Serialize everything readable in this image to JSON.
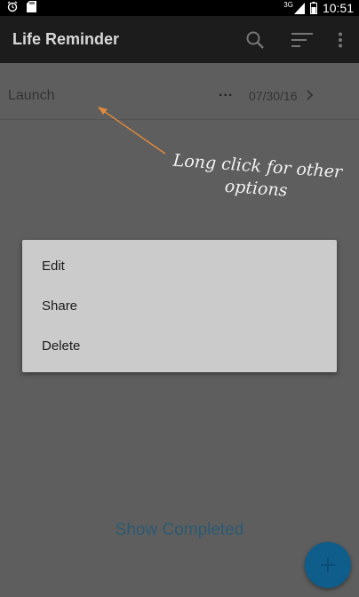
{
  "status_bar": {
    "time": "10:51",
    "network": "3G",
    "icons": [
      "alarm-icon",
      "sd-card-icon",
      "signal-icon",
      "battery-icon"
    ]
  },
  "app_bar": {
    "title": "Life Reminder",
    "actions": [
      "search-icon",
      "sort-icon",
      "overflow-menu-icon"
    ]
  },
  "list": {
    "items": [
      {
        "title": "Launch",
        "more": "...",
        "date": "07/30/16"
      }
    ]
  },
  "hint": {
    "text": "Long click for other options",
    "arrow_color": "#e08a3c"
  },
  "context_menu": {
    "items": [
      "Edit",
      "Share",
      "Delete"
    ]
  },
  "footer": {
    "show_completed_label": "Show Completed"
  },
  "fab": {
    "icon": "add-icon",
    "color": "#0f5d8b"
  }
}
